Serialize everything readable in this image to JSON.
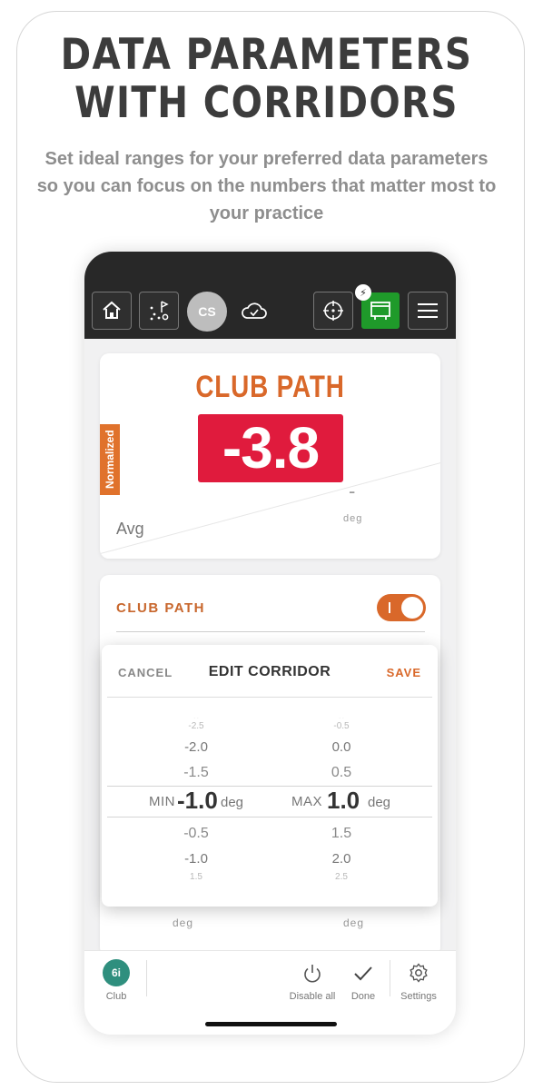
{
  "headline": {
    "line1": "DATA PARAMETERS",
    "line2": "WITH CORRIDORS"
  },
  "subtitle": "Set ideal ranges for your preferred data parameters so you can focus on the numbers that matter most to your practice",
  "topbar": {
    "avatar_initials": "CS",
    "icons": [
      "home-icon",
      "course-icon",
      "cloud-check-icon",
      "crosshair-icon",
      "device-icon",
      "menu-icon"
    ],
    "active_color": "#1f9a2a"
  },
  "metric_card": {
    "title": "CLUB PATH",
    "value": "-3.8",
    "badge": "Normalized",
    "avg_label": "Avg",
    "avg_value": "-",
    "unit": "deg",
    "value_color": "#e01b3d",
    "accent_color": "#d9682a"
  },
  "settings": {
    "label": "CLUB PATH",
    "toggle_on": true
  },
  "edit_corridor": {
    "cancel": "CANCEL",
    "title": "EDIT CORRIDOR",
    "save": "SAVE",
    "min": {
      "label": "MIN",
      "value": "-1.0",
      "unit": "deg",
      "above": [
        "-2.5",
        "-2.0",
        "-1.5"
      ],
      "below": [
        "-0.5",
        "-1.0",
        "1.5"
      ]
    },
    "max": {
      "label": "MAX",
      "value": "1.0",
      "unit": "deg",
      "above": [
        "-0.5",
        "0.0",
        "0.5"
      ],
      "below": [
        "1.5",
        "2.0",
        "2.5"
      ]
    }
  },
  "lower_units": [
    "deg",
    "deg"
  ],
  "bottombar": {
    "club_badge": "6i",
    "club_label": "Club",
    "disable_all": "Disable all",
    "done": "Done",
    "settings": "Settings"
  }
}
